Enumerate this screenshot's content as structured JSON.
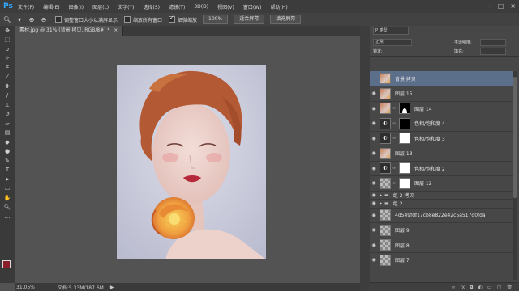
{
  "app": {
    "logo": "Ps"
  },
  "menu": [
    "文件(F)",
    "编辑(E)",
    "图像(I)",
    "图层(L)",
    "文字(Y)",
    "选择(S)",
    "滤镜(T)",
    "3D(D)",
    "视图(V)",
    "窗口(W)",
    "帮助(H)"
  ],
  "window_controls": [
    "–",
    "□",
    "×"
  ],
  "options": {
    "check1": "调整窗口大小以满屏显示",
    "check2": "缩放所有窗口",
    "check3": "细微缩放",
    "btn1": "100%",
    "btn2": "适合屏幕",
    "btn3": "填充屏幕"
  },
  "document": {
    "tab": "素材.jpg @ 31% (背景 拷贝, RGB/8#) *",
    "close": "×"
  },
  "status": {
    "zoom": "31.05%",
    "doc": "文档:5.33M/187.6M"
  },
  "layers_panel": {
    "filter": "P 类型",
    "blend": "正常",
    "opacity_label": "不透明度:",
    "lock_label": "锁定:",
    "fill_label": "填充:",
    "rows": [
      {
        "name": "背景 拷贝",
        "thumb": "photo",
        "mask": "",
        "selected": true,
        "eye": ""
      },
      {
        "name": "图层 15",
        "thumb": "photo",
        "mask": "",
        "selected": false,
        "eye": "◉"
      },
      {
        "name": "图层 14",
        "thumb": "photo",
        "mask": "shape",
        "selected": false,
        "eye": "◉"
      },
      {
        "name": "色相/饱和度 4",
        "thumb": "adj",
        "mask": "black",
        "selected": false,
        "eye": "◉"
      },
      {
        "name": "色相/饱和度 3",
        "thumb": "adj",
        "mask": "white",
        "selected": false,
        "eye": "◉"
      },
      {
        "name": "图层 13",
        "thumb": "photo",
        "mask": "",
        "selected": false,
        "eye": "◉"
      },
      {
        "name": "色相/饱和度 2",
        "thumb": "adj",
        "mask": "white",
        "selected": false,
        "eye": "◉"
      },
      {
        "name": "图层 12",
        "thumb": "trans",
        "mask": "white",
        "selected": false,
        "eye": "◉"
      }
    ],
    "folders": [
      {
        "name": "组 2 拷贝",
        "eye": "◉"
      },
      {
        "name": "组 2",
        "eye": "◉"
      }
    ],
    "rows2": [
      {
        "name": "4d549fdf17cb8e822e42c5a517d0fda",
        "thumb": "trans",
        "eye": "◉"
      },
      {
        "name": "图层 9",
        "thumb": "trans",
        "eye": "◉"
      },
      {
        "name": "图层 8",
        "thumb": "trans",
        "eye": "◉"
      },
      {
        "name": "图层 7",
        "thumb": "trans",
        "eye": "◉"
      }
    ],
    "footer_icons": [
      "link-icon",
      "fx-icon",
      "mask-icon",
      "adjustment-icon",
      "folder-icon",
      "new-layer-icon",
      "trash-icon"
    ],
    "footer_glyphs": [
      "∞",
      "fx",
      "◘",
      "◐",
      "▭",
      "▢",
      "🗑"
    ]
  }
}
